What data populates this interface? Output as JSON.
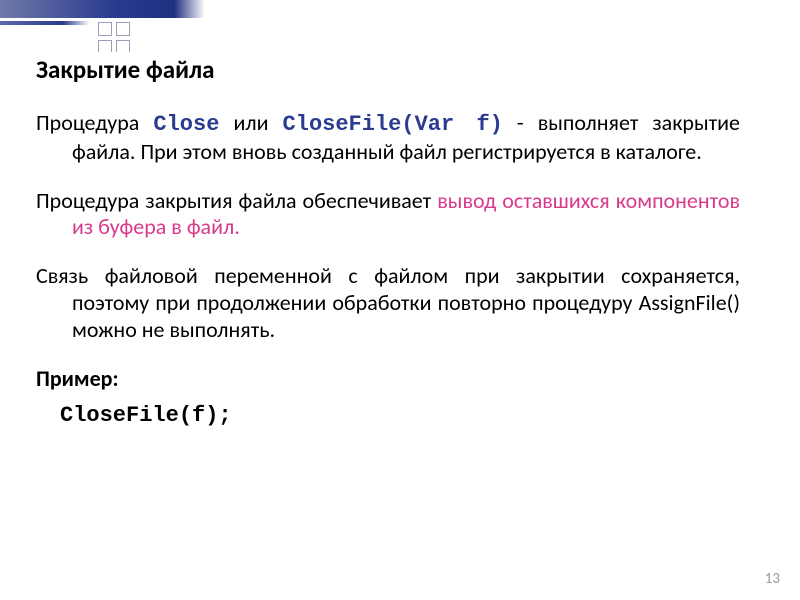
{
  "heading": "Закрытие файла",
  "p1": {
    "lead": "Процедура ",
    "proc1": "Close",
    "mid1": " или ",
    "proc2": "CloseFile(Var f)",
    "tail": " - выполняет закрытие файла. При этом вновь созданный файл регистрируется в каталоге."
  },
  "p2": {
    "lead": "Процедура закрытия файла обеспечивает ",
    "hl": "вывод оставшихся компонентов из буфера в файл."
  },
  "p3": "Связь файловой переменной с файлом при закрытии сохраняется, поэтому при продолжении обработки повторно процедуру AssignFile() можно не выполнять.",
  "example_label": "Пример:",
  "example_code": "CloseFile(f);",
  "page_number": "13"
}
